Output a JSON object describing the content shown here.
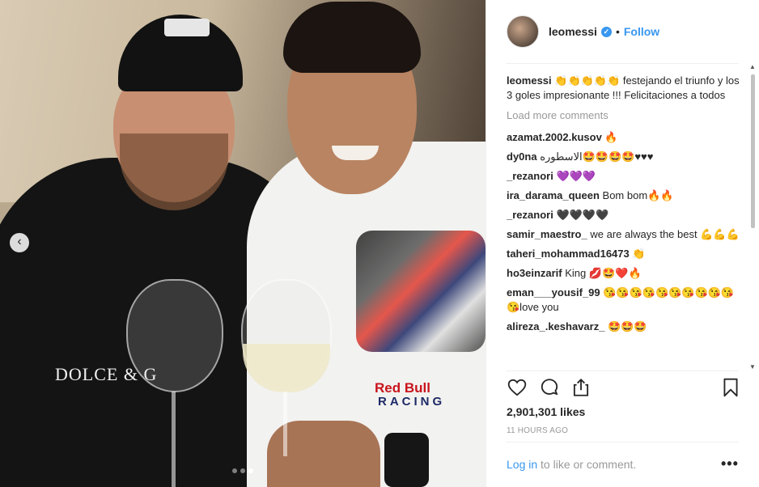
{
  "photo": {
    "alt_overlay_text": "DOLCE & G",
    "shirt_text_1": "Red Bull",
    "shirt_text_2": "RACING",
    "prev_icon": "chevron-left-icon",
    "carousel": {
      "count": 3,
      "active": 3
    }
  },
  "header": {
    "username": "leomessi",
    "verified_icon": "✓",
    "separator": "•",
    "follow_label": "Follow"
  },
  "caption": {
    "username": "leomessi",
    "text": "👏👏👏👏👏 festejando el triunfo y los 3 goles impresionante !!! Felicitaciones a todos"
  },
  "load_more_label": "Load more comments",
  "comments": [
    {
      "username": "azamat.2002.kusov",
      "text": "🔥"
    },
    {
      "username": "dy0na",
      "text": "الاسطوره🤩🤩🤩🤩♥♥♥"
    },
    {
      "username": "_rezanori",
      "text": "💜💜💜"
    },
    {
      "username": "ira_darama_queen",
      "text": "Bom bom🔥🔥"
    },
    {
      "username": "_rezanori",
      "text": "🖤🖤🖤🖤"
    },
    {
      "username": "samir_maestro_",
      "text": "we are always the best 💪💪💪"
    },
    {
      "username": "taheri_mohammad16473",
      "text": "👏"
    },
    {
      "username": "ho3einzarif",
      "text": "King 💋🤩❤️🔥"
    },
    {
      "username": "eman___yousif_99",
      "text": "😘😘😘😘😘😘😘😘😘😘😘love you"
    },
    {
      "username": "alireza_.keshavarz_",
      "text": "🤩🤩🤩"
    }
  ],
  "actions": {
    "like_icon": "heart-icon",
    "comment_icon": "comment-icon",
    "share_icon": "share-icon",
    "save_icon": "bookmark-icon"
  },
  "likes": "2,901,301 likes",
  "time": "11 HOURS AGO",
  "login": {
    "link": "Log in",
    "text": " to like or comment."
  },
  "more_label": "•••"
}
